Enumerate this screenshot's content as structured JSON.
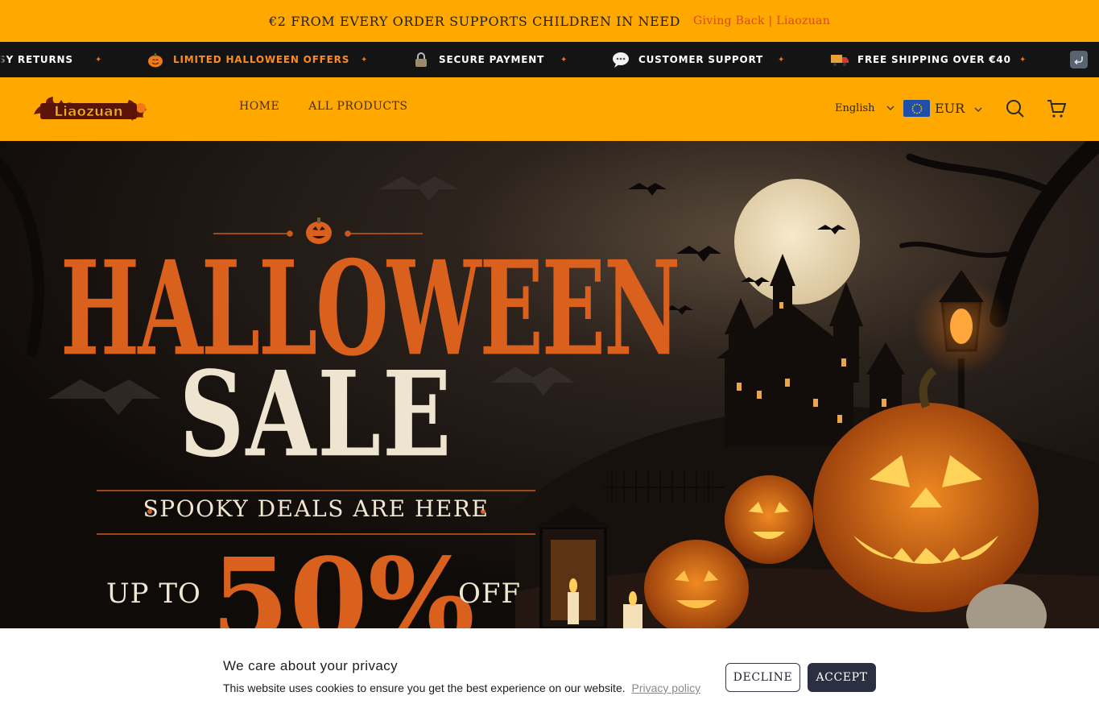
{
  "announcement": {
    "message": "€2 FROM EVERY ORDER SUPPORTS CHILDREN IN NEED",
    "link": "Giving Back | Liaozuan"
  },
  "marquee": {
    "items": [
      {
        "label": "SY RETURNS",
        "icon": "returns-icon"
      },
      {
        "label": "LIMITED HALLOWEEN OFFERS",
        "icon": "pumpkin-icon"
      },
      {
        "label": "SECURE PAYMENT",
        "icon": "lock-icon"
      },
      {
        "label": "CUSTOMER SUPPORT",
        "icon": "speech-bubble-icon"
      },
      {
        "label": "FREE SHIPPING OVER €40",
        "icon": "delivery-truck-icon"
      }
    ],
    "separator_icon": "star-separator-icon",
    "end_icon": "return-arrow-icon"
  },
  "header": {
    "logo_text": "Liaozuan",
    "nav": [
      "HOME",
      "ALL PRODUCTS"
    ],
    "language": "English",
    "currency": "EUR",
    "currency_icon": "eu-flag-icon",
    "search_icon": "search-icon",
    "cart_icon": "cart-icon"
  },
  "hero": {
    "title": "HALLOWEEN",
    "subtitle": "SALE",
    "tagline": "SPOOKY DEALS ARE HERE",
    "prefix": "UP TO",
    "discount": "50%",
    "suffix": "OFF"
  },
  "cookie": {
    "title": "We care about your privacy",
    "text": "This website uses cookies to ensure you get the best experience on our website.",
    "policy_link": "Privacy policy",
    "decline": "DECLINE",
    "accept": "ACCEPT"
  },
  "colors": {
    "brand_orange": "#ffa800",
    "marquee_bg": "#141414",
    "accent_orange": "#d9601d",
    "accept_button": "#2a3042"
  }
}
